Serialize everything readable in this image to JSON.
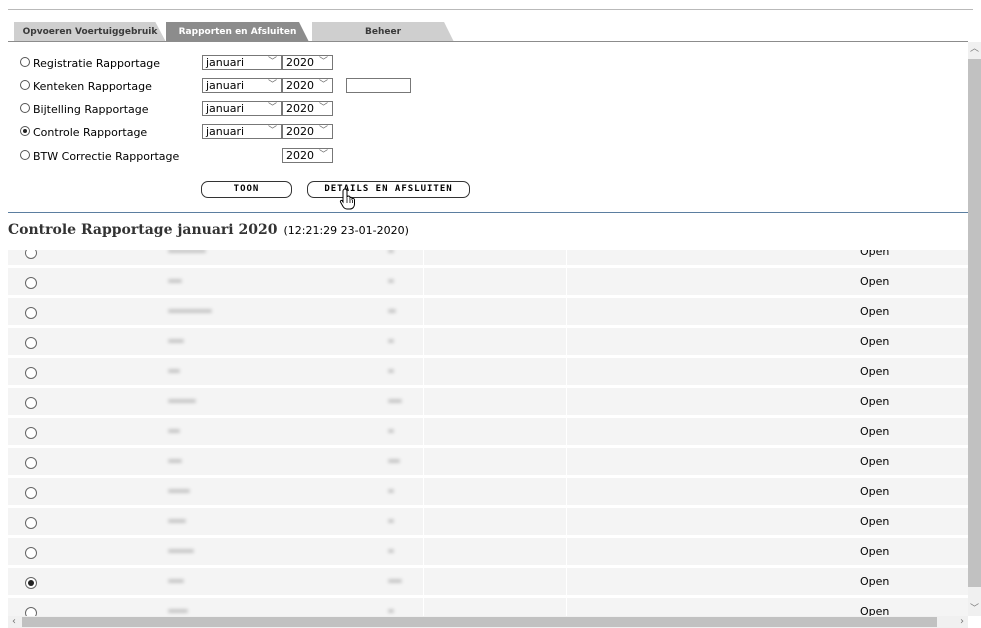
{
  "tabs": [
    {
      "label": "Opvoeren Voertuiggebruik"
    },
    {
      "label": "Rapporten en Afsluiten"
    },
    {
      "label": "Beheer"
    }
  ],
  "form": {
    "rows": [
      {
        "label": "Registratie Rapportage",
        "month": "januari",
        "year": "2020",
        "checked": false
      },
      {
        "label": "Kenteken Rapportage",
        "month": "januari",
        "year": "2020",
        "checked": false
      },
      {
        "label": "Bijtelling Rapportage",
        "month": "januari",
        "year": "2020",
        "checked": false
      },
      {
        "label": "Controle Rapportage",
        "month": "januari",
        "year": "2020",
        "checked": true
      },
      {
        "label": "BTW Correctie Rapportage",
        "month": "",
        "year": "2020",
        "checked": false
      }
    ],
    "toon_label": "TOON",
    "details_label": "DETAILS EN AFSLUITEN"
  },
  "report": {
    "title": "Controle Rapportage januari 2020",
    "timestamp": "(12:21:29 23-01-2020)"
  },
  "table": {
    "rows": [
      {
        "status": "Open",
        "selected": false
      },
      {
        "status": "Open",
        "selected": false
      },
      {
        "status": "Open",
        "selected": false
      },
      {
        "status": "Open",
        "selected": false
      },
      {
        "status": "Open",
        "selected": false
      },
      {
        "status": "Open",
        "selected": false
      },
      {
        "status": "Open",
        "selected": false
      },
      {
        "status": "Open",
        "selected": false
      },
      {
        "status": "Open",
        "selected": false
      },
      {
        "status": "Open",
        "selected": false
      },
      {
        "status": "Open",
        "selected": false
      },
      {
        "status": "Open",
        "selected": true
      },
      {
        "status": "Open",
        "selected": false
      }
    ]
  },
  "icons": {
    "dropdown": "chevron-down-icon",
    "cursor": "hand-pointer-icon",
    "scroll_up": "chevron-up-icon",
    "scroll_down": "chevron-down-icon",
    "scroll_left": "chevron-left-icon",
    "scroll_right": "chevron-right-icon"
  },
  "colors": {
    "active_tab": "#8c8c8c",
    "inactive_tab": "#cfcfcf",
    "separator": "#5b7ea0"
  }
}
